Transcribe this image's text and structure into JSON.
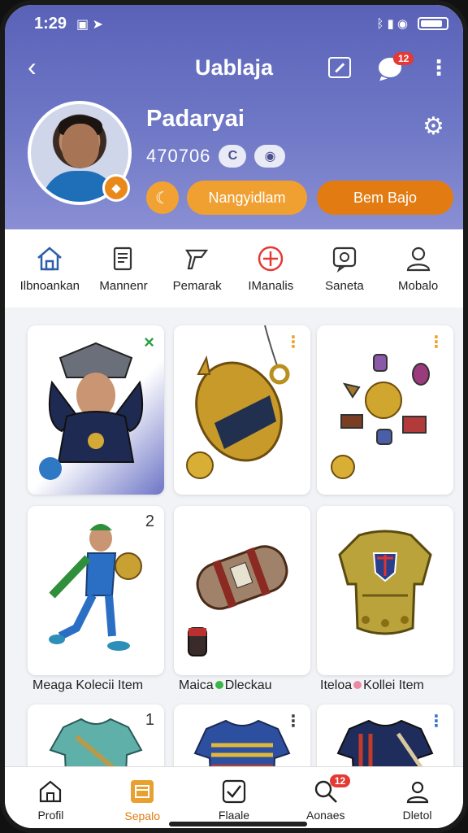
{
  "status_bar": {
    "time": "1:29",
    "icons_left": "▣ ➤",
    "icons_right": "ᛒ ▮ ◉"
  },
  "topbar": {
    "title": "Uablaja",
    "chat_badge": "12"
  },
  "profile": {
    "name": "Padaryai",
    "id": "470706",
    "icon1": "C",
    "icon2": "◉",
    "button1": "Nangyidlam",
    "button2": "Bem Bajo"
  },
  "categories": [
    {
      "label": "Ilbnoankan",
      "icon": "home-icon",
      "color": "#2d5fa8"
    },
    {
      "label": "Mannenr",
      "icon": "document-icon",
      "color": "#333333"
    },
    {
      "label": "Pemarak",
      "icon": "tag-icon",
      "color": "#333333"
    },
    {
      "label": "IManalis",
      "icon": "plus-circle-icon",
      "color": "#e53935"
    },
    {
      "label": "Saneta",
      "icon": "chat-icon",
      "color": "#333333"
    },
    {
      "label": "Mobalo",
      "icon": "person-icon",
      "color": "#333333"
    }
  ],
  "cards": {
    "row1": [
      {
        "corner": "×",
        "item": "player-figure"
      },
      {
        "corner": "⋮",
        "item": "golden-pendant"
      },
      {
        "corner": "⋮",
        "item": "gem-cluster"
      }
    ],
    "row2": [
      {
        "corner": "2",
        "item": "running-player"
      },
      {
        "corner": "",
        "item": "barrel-scroll"
      },
      {
        "corner": "",
        "item": "golden-armor"
      }
    ],
    "row3": [
      {
        "corner": "1",
        "item": "teal-jersey"
      },
      {
        "corner": "⋮",
        "item": "blue-striped-jersey"
      },
      {
        "corner": "⋮",
        "item": "navy-jersey"
      }
    ]
  },
  "captions": [
    {
      "text_a": "Meaga Kolecii Item",
      "text_b": ""
    },
    {
      "text_a": "Maica",
      "text_b": "Dleckau"
    },
    {
      "text_a": "Iteloa",
      "text_b": "Kollei Item"
    }
  ],
  "bottom_nav": [
    {
      "label": "Profil",
      "icon": "home-icon",
      "active": false
    },
    {
      "label": "Sepalo",
      "icon": "wallet-icon",
      "active": true
    },
    {
      "label": "Flaale",
      "icon": "check-box-icon",
      "active": false
    },
    {
      "label": "Aonaes",
      "icon": "search-icon",
      "active": false,
      "badge": "12"
    },
    {
      "label": "Dletol",
      "icon": "person-icon",
      "active": false
    }
  ],
  "colors": {
    "header_top": "#5a62b8",
    "accent_orange": "#e27c12",
    "accent_light_orange": "#f0a030",
    "badge_red": "#e53935"
  }
}
